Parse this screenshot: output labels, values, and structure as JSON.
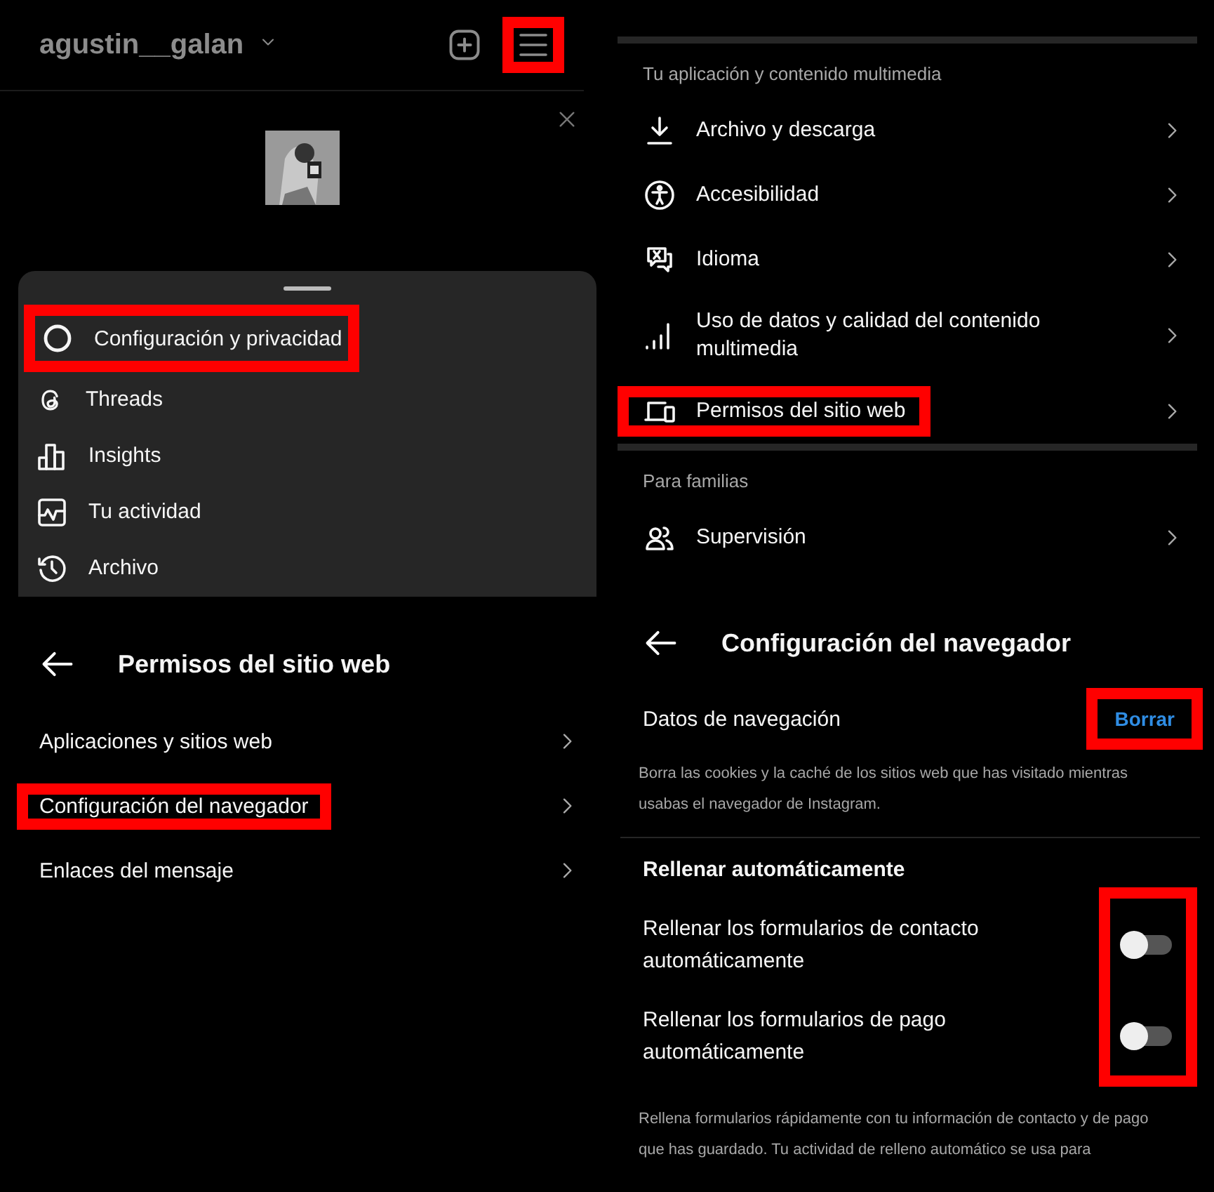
{
  "profile_screen": {
    "username": "agustin__galan",
    "menu_highlighted": true,
    "menu_items": [
      {
        "kind": "gear",
        "label": "Configuración y privacidad",
        "highlighted": true
      },
      {
        "kind": "threads",
        "label": "Threads",
        "highlighted": false
      },
      {
        "kind": "bars",
        "label": "Insights",
        "highlighted": false
      },
      {
        "kind": "activity",
        "label": "Tu actividad",
        "highlighted": false
      },
      {
        "kind": "history",
        "label": "Archivo",
        "highlighted": false
      }
    ]
  },
  "permissions_screen": {
    "title": "Permisos del sitio web",
    "items": [
      {
        "label": "Aplicaciones y sitios web",
        "highlighted": false
      },
      {
        "label": "Configuración del navegador",
        "highlighted": true
      },
      {
        "label": "Enlaces del mensaje",
        "highlighted": false
      }
    ]
  },
  "settings_screen": {
    "sections": [
      {
        "header": "Tu aplicación y contenido multimedia",
        "items": [
          {
            "kind": "download",
            "label": "Archivo y descarga",
            "highlighted": false
          },
          {
            "kind": "accessibility",
            "label": "Accesibilidad",
            "highlighted": false
          },
          {
            "kind": "language",
            "label": "Idioma",
            "highlighted": false
          },
          {
            "kind": "signal",
            "label": "Uso de datos y calidad del contenido multimedia",
            "highlighted": false
          },
          {
            "kind": "devices",
            "label": "Permisos del sitio web",
            "highlighted": true
          }
        ]
      },
      {
        "header": "Para familias",
        "items": [
          {
            "kind": "people",
            "label": "Supervisión",
            "highlighted": false
          }
        ]
      }
    ]
  },
  "browser_screen": {
    "title": "Configuración del navegador",
    "browsing_data": {
      "label": "Datos de navegación",
      "button": "Borrar",
      "button_highlighted": true,
      "description": "Borra las cookies y la caché de los sitios web que has visitado mientras usabas el navegador de Instagram."
    },
    "autofill": {
      "header": "Rellenar automáticamente",
      "toggles_highlighted": true,
      "toggles": [
        {
          "label": "Rellenar los formularios de contacto automáticamente",
          "on": false
        },
        {
          "label": "Rellenar los formularios de pago automáticamente",
          "on": false
        }
      ],
      "description": "Rellena formularios rápidamente con tu información de contacto y de pago que has guardado. Tu actividad de relleno automático se usa para"
    }
  }
}
